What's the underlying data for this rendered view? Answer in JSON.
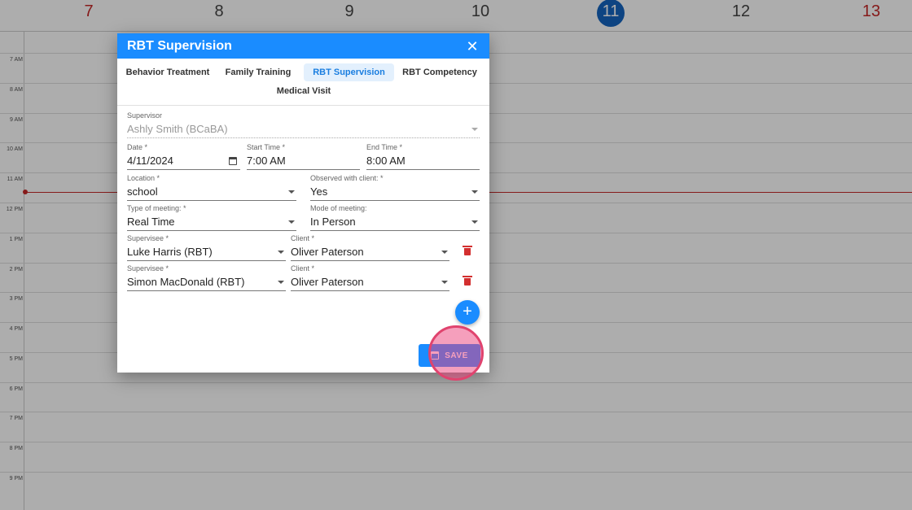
{
  "calendar": {
    "days": [
      {
        "label": "7",
        "weekend": true
      },
      {
        "label": "8",
        "weekend": false
      },
      {
        "label": "9",
        "weekend": false
      },
      {
        "label": "10",
        "weekend": false
      },
      {
        "label": "11",
        "weekend": false,
        "today": true
      },
      {
        "label": "12",
        "weekend": false
      },
      {
        "label": "13",
        "weekend": true
      }
    ],
    "hours": [
      "7 AM",
      "8 AM",
      "9 AM",
      "10 AM",
      "11 AM",
      "12 PM",
      "1 PM",
      "2 PM",
      "3 PM",
      "4 PM",
      "5 PM",
      "6 PM",
      "7 PM",
      "8 PM",
      "9 PM"
    ]
  },
  "dialog": {
    "title": "RBT Supervision",
    "close_icon": "close-icon",
    "tabs": [
      "Behavior Treatment",
      "Family Training",
      "RBT Supervision",
      "RBT Competency",
      "Medical Visit"
    ],
    "active_tab": "RBT Supervision",
    "supervisor": {
      "label": "Supervisor",
      "value": "Ashly Smith (BCaBA)"
    },
    "date": {
      "label": "Date *",
      "value": "4/11/2024"
    },
    "start_time": {
      "label": "Start Time *",
      "value": "7:00 AM"
    },
    "end_time": {
      "label": "End Time *",
      "value": "8:00 AM"
    },
    "location": {
      "label": "Location *",
      "value": "school"
    },
    "observed": {
      "label": "Observed with client: *",
      "value": "Yes"
    },
    "meeting_type": {
      "label": "Type of meeting: *",
      "value": "Real Time"
    },
    "meeting_mode": {
      "label": "Mode of meeting:",
      "value": "In Person"
    },
    "rows": [
      {
        "supervisee_label": "Supervisee *",
        "supervisee": "Luke Harris (RBT)",
        "client_label": "Client *",
        "client": "Oliver Paterson"
      },
      {
        "supervisee_label": "Supervisee *",
        "supervisee": "Simon MacDonald (RBT)",
        "client_label": "Client *",
        "client": "Oliver Paterson"
      }
    ],
    "add_label": "+",
    "save_label": "SAVE"
  },
  "colors": {
    "header": "#1a8cff",
    "weekend": "#c62828",
    "today": "#1565c0",
    "delete": "#d32f2f",
    "highlight": "#e0436e"
  }
}
